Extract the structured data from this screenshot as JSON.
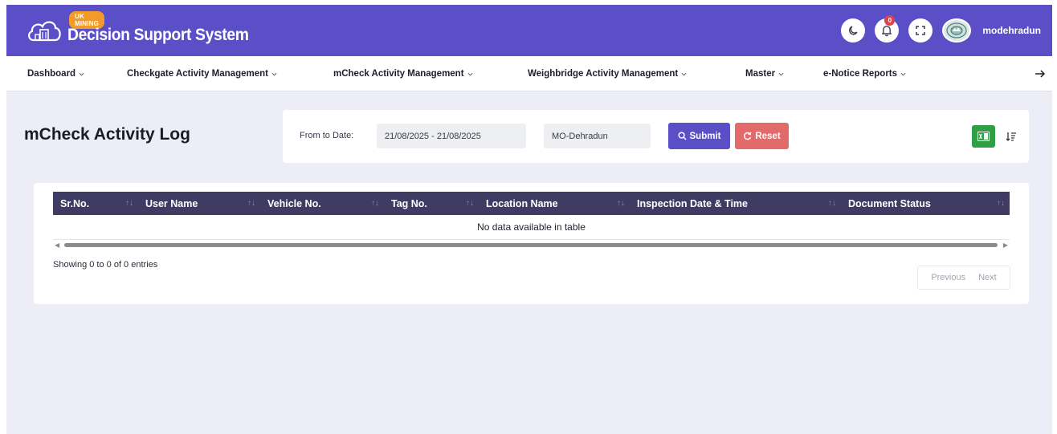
{
  "header": {
    "badge": "UK MINING",
    "title": "Decision Support System",
    "notification_count": "0",
    "username": "modehradun",
    "brand_color": "#5b4fc7"
  },
  "menu": {
    "items": [
      {
        "label": "Dashboard"
      },
      {
        "label": "Checkgate Activity Management"
      },
      {
        "label": "mCheck Activity Management"
      },
      {
        "label": "Weighbridge Activity Management"
      },
      {
        "label": "Master"
      },
      {
        "label": "e-Notice Reports"
      }
    ],
    "arrow_icon": "arrow-right-icon"
  },
  "page": {
    "title": "mCheck Activity Log"
  },
  "filters": {
    "date_label": "From to Date:",
    "date_range": "21/08/2025 - 21/08/2025",
    "office": "MO-Dehradun",
    "submit_label": "Submit",
    "reset_label": "Reset"
  },
  "table": {
    "columns": [
      "Sr.No.",
      "User Name",
      "Vehicle No.",
      "Tag No.",
      "Location Name",
      "Inspection Date & Time",
      "Document Status"
    ],
    "empty_message": "No data available in table",
    "info": "Showing 0 to 0 of 0 entries",
    "prev_label": "Previous",
    "next_label": "Next"
  },
  "colors": {
    "header": "#5b4fc7",
    "table_head": "#3f3b63",
    "reset": "#e26a6a",
    "excel": "#2f9e44",
    "badge": "#f29b2a"
  }
}
